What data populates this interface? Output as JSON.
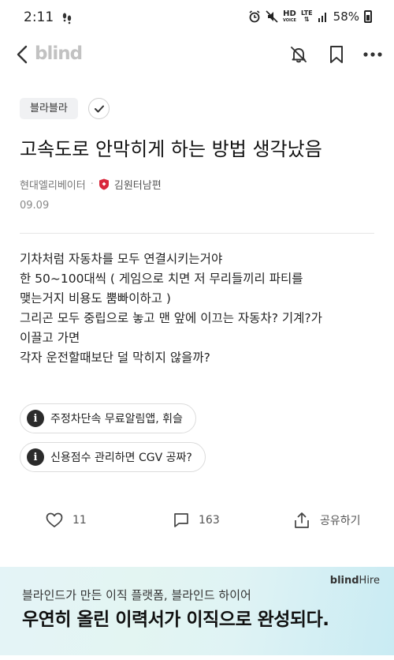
{
  "status_bar": {
    "time": "2:11",
    "hd": "HD",
    "voice": "VOICE",
    "lte": "LTE",
    "battery": "58%"
  },
  "nav": {
    "logo": "blind",
    "icons": [
      "back-icon",
      "bell-off-icon",
      "bookmark-icon",
      "more-icon"
    ]
  },
  "channel": {
    "label": "블라블라"
  },
  "post": {
    "title": "고속도로 안막히게 하는 방법 생각났음",
    "company": "현대엘리베이터",
    "author": "김원터남편",
    "date": "09.09",
    "body_lines": [
      "기차처럼 자동차를 모두 연결시키는거야",
      "한 50~100대씩 ( 게임으로 치면 저 무리들끼리 파티를",
      "맺는거지 비용도 뿜빠이하고 )",
      "그리곤 모두 중립으로 놓고 맨 앞에 이끄는 자동차? 기계?가",
      "이끌고 가면",
      "각자 운전할때보단 덜 막히지 않을까?"
    ]
  },
  "related": [
    {
      "label": "주정차단속 무료알림앱, 휘슬"
    },
    {
      "label": "신용점수 관리하면 CGV 공짜?"
    }
  ],
  "actions": {
    "likes": "11",
    "comments": "163",
    "share_label": "공유하기"
  },
  "banner": {
    "brand": "blind",
    "brand_suffix": "Hire",
    "subtitle": "블라인드가 만든 이직 플랫폼, 블라인드 하이어",
    "headline": "우연히 올린 이력서가 이직으로 완성되다."
  },
  "colors": {
    "accent_badge": "#d9263b",
    "banner_start": "#e4f4f7",
    "banner_end": "#c9ebf3"
  }
}
